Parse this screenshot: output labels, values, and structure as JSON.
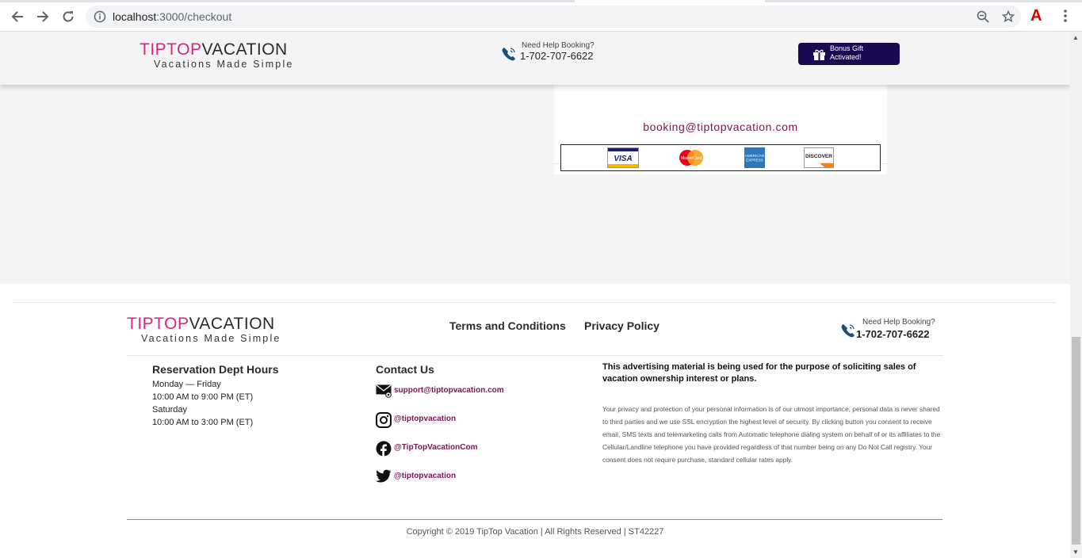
{
  "browser": {
    "url_host": "localhost",
    "url_path": ":3000/checkout",
    "icons": [
      "back-icon",
      "forward-icon",
      "reload-icon",
      "info-icon",
      "zoom-icon",
      "bookmark-star-icon",
      "extension-icon",
      "menu-icon"
    ]
  },
  "header": {
    "logo_part1": "TIPTOP",
    "logo_part2": "VACATION",
    "logo_tagline": "Vacations Made Simple",
    "help_label": "Need Help Booking?",
    "help_phone": "1-702-707-6622",
    "bonus_line1": "Bonus Gift",
    "bonus_line2": "Activated!"
  },
  "card": {
    "email": "booking@tiptopvacation.com",
    "payment_methods": [
      "VISA",
      "MasterCard",
      "AMERICAN EXPRESS",
      "DISCOVER"
    ]
  },
  "footer": {
    "logo_part1": "TIPTOP",
    "logo_part2": "VACATION",
    "logo_tagline": "Vacations Made Simple",
    "links": {
      "terms": "Terms and Conditions",
      "privacy": "Privacy Policy"
    },
    "help_label": "Need Help Booking?",
    "help_phone": "1-702-707-6622",
    "hours": {
      "title": "Reservation Dept Hours",
      "lines": [
        "Monday — Friday",
        "10:00 AM to 9:00 PM (ET)",
        "Saturday",
        "10:00 AM to 3:00 PM (ET)"
      ]
    },
    "contact": {
      "title": "Contact Us",
      "email": "support@tiptopvacation.com",
      "instagram": "@tiptopvacation",
      "facebook": "@TipTopVacationCom",
      "twitter": "@tiptopvacation"
    },
    "disclaimer_bold": "This advertising material is being used for the purpose of soliciting sales of vacation ownership interest or plans.",
    "disclaimer_fine": "Your privacy and protection of your personal information is of our utmost importance, personal data is never shared to third parties and we use SSL encryption the highest level of security. By clicking button you consent to receive email, SMS texts and telemarketing calls from Automatic telephone dialing system on behalf of or its affiliates to the Cellular/Landline telephone you have provided regardless of that number being on any Do Not Call registry. Your consent does not require purchase, standard cellular rates apply.",
    "copyright": "Copyright © 2019 TipTop Vacation | All Rights Reserved | ST42227"
  },
  "colors": {
    "brand_pink": "#d8237f",
    "brand_plum": "#7a1654",
    "bonus_navy": "#1a0a52"
  }
}
